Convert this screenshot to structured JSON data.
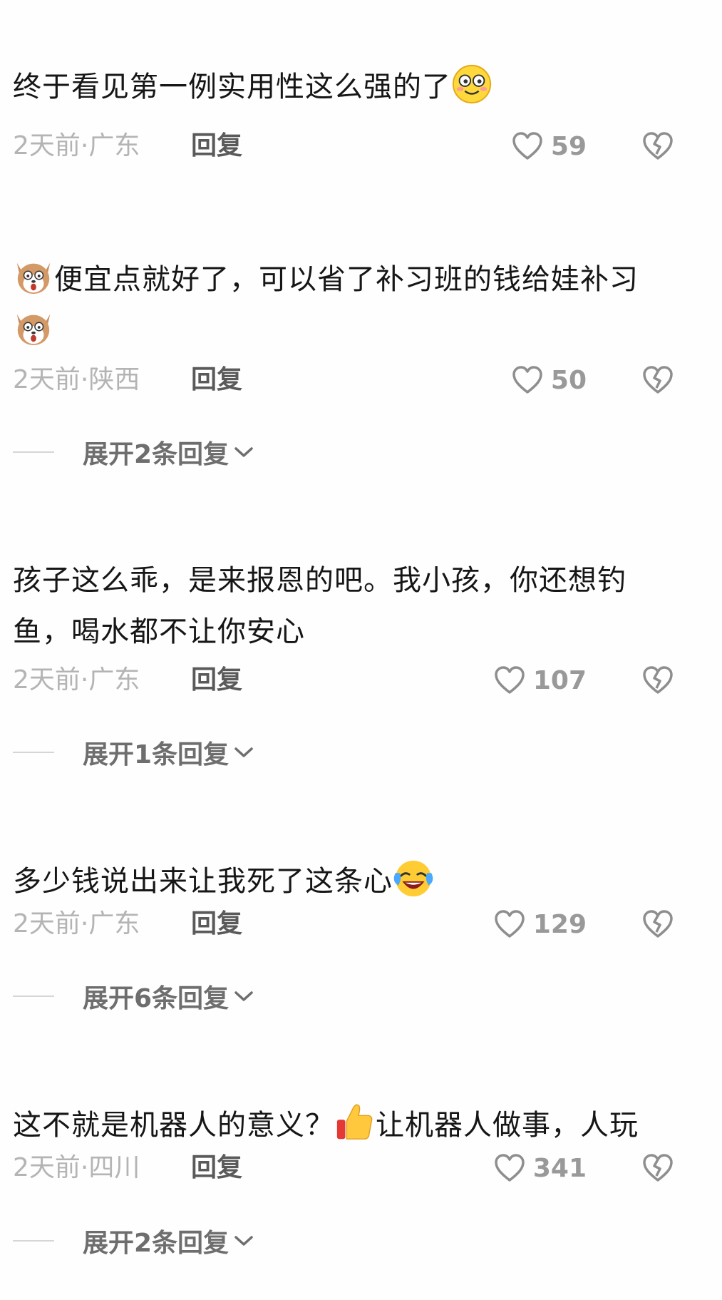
{
  "comments": [
    {
      "text": "终于看见第一例实用性这么强的了",
      "emoji_after": "smile-emoji",
      "time": "2天前",
      "sep": "·",
      "location": "广东",
      "reply_label": "回复",
      "likes": "59",
      "expand": null
    },
    {
      "emoji_before": "dog-emoji",
      "text": "便宜点就好了，可以省了补习班的钱给娃补习",
      "emoji_line2": "dog-emoji",
      "time": "2天前",
      "sep": "·",
      "location": "陕西",
      "reply_label": "回复",
      "likes": "50",
      "expand": "展开2条回复"
    },
    {
      "text": "孩子这么乖，是来报恩的吧。我小孩，你还想钓鱼，喝水都不让你安心",
      "time": "2天前",
      "sep": "·",
      "location": "广东",
      "reply_label": "回复",
      "likes": "107",
      "expand": "展开1条回复"
    },
    {
      "text": "多少钱说出来让我死了这条心",
      "emoji_after": "laugh-cry-emoji",
      "time": "2天前",
      "sep": "·",
      "location": "广东",
      "reply_label": "回复",
      "likes": "129",
      "expand": "展开6条回复"
    },
    {
      "text_a": "这不就是机器人的意义？",
      "emoji_mid": "thumbs-up-emoji",
      "text_b": "让机器人做事，人玩",
      "time": "2天前",
      "sep": "·",
      "location": "四川",
      "reply_label": "回复",
      "likes": "341",
      "expand": "展开2条回复"
    }
  ],
  "colors": {
    "meta": "#b4b4b4",
    "reply": "#5a5a5a",
    "like": "#999999",
    "expand": "#6e6e6e"
  }
}
